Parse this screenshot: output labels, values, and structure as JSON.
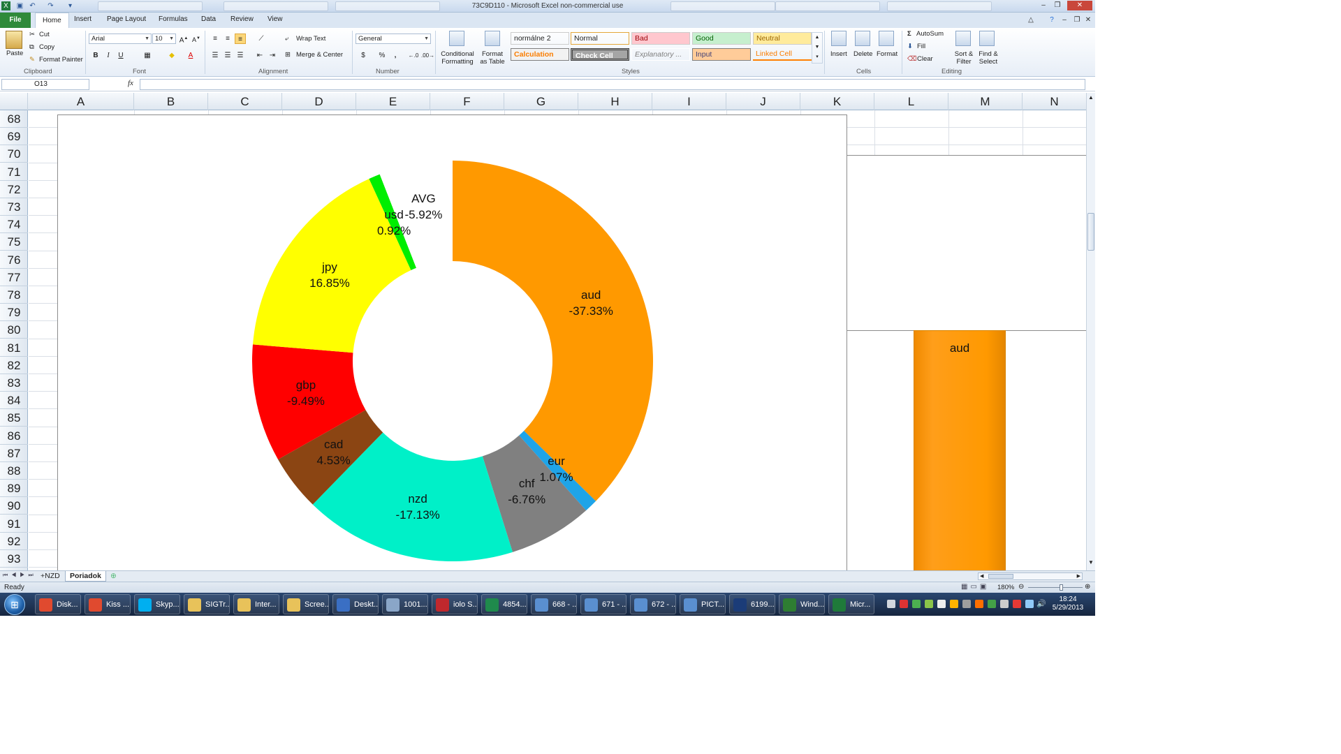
{
  "window": {
    "title": "73C9D110  -  Microsoft Excel non-commercial use"
  },
  "ribbon_tabs": [
    "File",
    "Home",
    "Insert",
    "Page Layout",
    "Formulas",
    "Data",
    "Review",
    "View"
  ],
  "clipboard": {
    "paste": "Paste",
    "cut": "Cut",
    "copy": "Copy",
    "format_painter": "Format Painter",
    "group": "Clipboard"
  },
  "font": {
    "name": "Arial",
    "size": "10",
    "group": "Font",
    "bold": "B",
    "italic": "I",
    "underline": "U"
  },
  "alignment": {
    "wrap_text": "Wrap Text",
    "merge_center": "Merge & Center",
    "group": "Alignment"
  },
  "number": {
    "format": "General",
    "currency": "$",
    "percent": "%",
    "comma": ",",
    "group": "Number"
  },
  "styles": {
    "conditional": "Conditional Formatting",
    "format_table": "Format as Table",
    "cells": [
      {
        "label": "normálne 2",
        "bg": "#ffffff",
        "fg": "#000000"
      },
      {
        "label": "Normal",
        "bg": "#ffffff",
        "fg": "#000000"
      },
      {
        "label": "Bad",
        "bg": "#ffc7ce",
        "fg": "#9c0006"
      },
      {
        "label": "Good",
        "bg": "#c6efce",
        "fg": "#006100"
      },
      {
        "label": "Neutral",
        "bg": "#ffeb9c",
        "fg": "#9c6500"
      },
      {
        "label": "Calculation",
        "bg": "#f2f2f2",
        "fg": "#fa7d00"
      },
      {
        "label": "Check Cell",
        "bg": "#a5a5a5",
        "fg": "#ffffff"
      },
      {
        "label": "Explanatory ...",
        "bg": "#ffffff",
        "fg": "#7f7f7f"
      },
      {
        "label": "Input",
        "bg": "#ffcc99",
        "fg": "#3f3f76"
      },
      {
        "label": "Linked Cell",
        "bg": "#ffffff",
        "fg": "#fa7d00"
      }
    ],
    "group": "Styles"
  },
  "cells_group": {
    "insert": "Insert",
    "delete": "Delete",
    "format": "Format",
    "group": "Cells"
  },
  "editing": {
    "autosum": "AutoSum",
    "fill": "Fill",
    "clear": "Clear",
    "sort_filter": "Sort & Filter",
    "find_select": "Find & Select",
    "group": "Editing"
  },
  "formula_bar": {
    "name_box": "O13",
    "fx": "fx",
    "formula": ""
  },
  "columns": [
    "A",
    "B",
    "C",
    "D",
    "E",
    "F",
    "G",
    "H",
    "I",
    "J",
    "K",
    "L",
    "M",
    "N"
  ],
  "rows": [
    "68",
    "69",
    "70",
    "71",
    "72",
    "73",
    "74",
    "75",
    "76",
    "77",
    "78",
    "79",
    "80",
    "81",
    "82",
    "83",
    "84",
    "85",
    "86",
    "87",
    "88",
    "89",
    "90",
    "91",
    "92",
    "93"
  ],
  "chart_data": [
    {
      "type": "doughnut",
      "title": "",
      "center_label": {
        "name": "AVG",
        "value": "-5.92%"
      },
      "series": [
        {
          "name": "aud",
          "label": "-37.33%",
          "value": 37.33,
          "color": "#ff9900"
        },
        {
          "name": "eur",
          "label": "1.07%",
          "value": 1.07,
          "color": "#1fa4e8"
        },
        {
          "name": "chf",
          "label": "-6.76%",
          "value": 6.76,
          "color": "#808080"
        },
        {
          "name": "nzd",
          "label": "-17.13%",
          "value": 17.13,
          "color": "#00f0c8"
        },
        {
          "name": "cad",
          "label": "4.53%",
          "value": 4.53,
          "color": "#8b4513"
        },
        {
          "name": "gbp",
          "label": "-9.49%",
          "value": 9.49,
          "color": "#ff0000"
        },
        {
          "name": "jpy",
          "label": "16.85%",
          "value": 16.85,
          "color": "#ffff00"
        },
        {
          "name": "usd",
          "label": "0.92%",
          "value": 0.92,
          "color": "#00ee00"
        },
        {
          "name": "AVG",
          "label": "-5.92%",
          "value": 5.92,
          "color": "#ffffff"
        }
      ]
    },
    {
      "type": "bar",
      "categories": [
        "aud"
      ],
      "values": [
        37.33
      ],
      "color": "#ff9900"
    }
  ],
  "sheets": [
    "+NZD",
    "Poriadok"
  ],
  "active_sheet": "Poriadok",
  "status": {
    "ready": "Ready",
    "zoom": "180%"
  },
  "taskbar": {
    "items": [
      {
        "label": "Disk...",
        "color": "#e04a2f"
      },
      {
        "label": "Kiss ...",
        "color": "#e04a2f"
      },
      {
        "label": "Skyp...",
        "color": "#00aff0"
      },
      {
        "label": "SIGTr...",
        "color": "#e8c25a"
      },
      {
        "label": "Inter...",
        "color": "#e8c25a"
      },
      {
        "label": "Scree...",
        "color": "#e8c25a"
      },
      {
        "label": "Deskt...",
        "color": "#3a6fc4"
      },
      {
        "label": "1001...",
        "color": "#8aa6c8"
      },
      {
        "label": "iolo S...",
        "color": "#c0282d"
      },
      {
        "label": "4854...",
        "color": "#1f8a4c"
      },
      {
        "label": "668 - ...",
        "color": "#5a8fd0"
      },
      {
        "label": "671 - ...",
        "color": "#5a8fd0"
      },
      {
        "label": "672 - ...",
        "color": "#5a8fd0"
      },
      {
        "label": "PICT...",
        "color": "#5a8fd0"
      },
      {
        "label": "6199...",
        "color": "#1b3c78"
      },
      {
        "label": "Wind...",
        "color": "#2e7d32"
      },
      {
        "label": "Micr...",
        "color": "#1f7a3a"
      }
    ],
    "time": "18:24",
    "date": "5/29/2013"
  }
}
